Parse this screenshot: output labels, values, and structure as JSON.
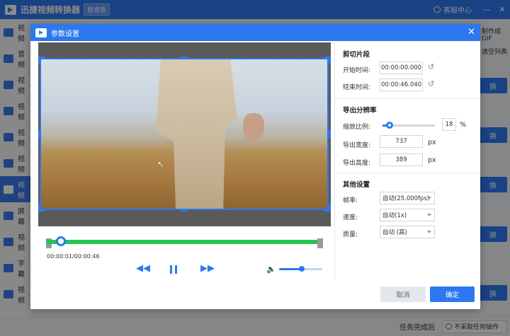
{
  "app": {
    "title": "迅捷视频转换器",
    "badge": "极速版",
    "support_label": "客服中心",
    "min_glyph": "—",
    "close_glyph": "✕"
  },
  "sidebar": {
    "items": [
      {
        "label": "视频"
      },
      {
        "label": "音频"
      },
      {
        "label": "视频"
      },
      {
        "label": "视频"
      },
      {
        "label": "视频"
      },
      {
        "label": "视频"
      },
      {
        "label": "视频"
      },
      {
        "label": "屏幕"
      },
      {
        "label": "视频"
      },
      {
        "label": "字幕"
      },
      {
        "label": "视频"
      }
    ]
  },
  "background": {
    "make_gif": "制作成GIF",
    "clear_list": "清空列表",
    "convert_label": "换",
    "convert_labels": [
      "换",
      "换",
      "换",
      "换",
      "换"
    ],
    "task_done_label": "任务完成后",
    "task_done_option": "不采取任何操作"
  },
  "dialog": {
    "title": "参数设置",
    "close_glyph": "✕",
    "time_current": "00:00:01/00:00:46",
    "cursor_glyph": "↖",
    "volume_glyph": "🔈",
    "rewind_glyph": "◀◀",
    "forward_glyph": "▶▶",
    "clip": {
      "section_title": "剪切片段",
      "start_label": "开始时间:",
      "start_value": "00:00:00.000",
      "end_label": "结束时间:",
      "end_value": "00:00:46.040",
      "reset_glyph": "↺"
    },
    "resolution": {
      "section_title": "导出分辨率",
      "scale_label": "缩放比例:",
      "scale_value": "18",
      "scale_unit": "%",
      "width_label": "导出宽度:",
      "width_value": "737",
      "height_label": "导出高度:",
      "height_value": "389",
      "px_unit": "px"
    },
    "other": {
      "section_title": "其他设置",
      "fps_label": "帧率:",
      "fps_value": "自动(25.000fps)",
      "speed_label": "速度:",
      "speed_value": "自动(1x)",
      "quality_label": "质量:",
      "quality_value": "自动 (高)"
    },
    "cancel_label": "取消",
    "ok_label": "确定"
  },
  "colors": {
    "accent": "#2d78f0",
    "timeline": "#23c552"
  }
}
